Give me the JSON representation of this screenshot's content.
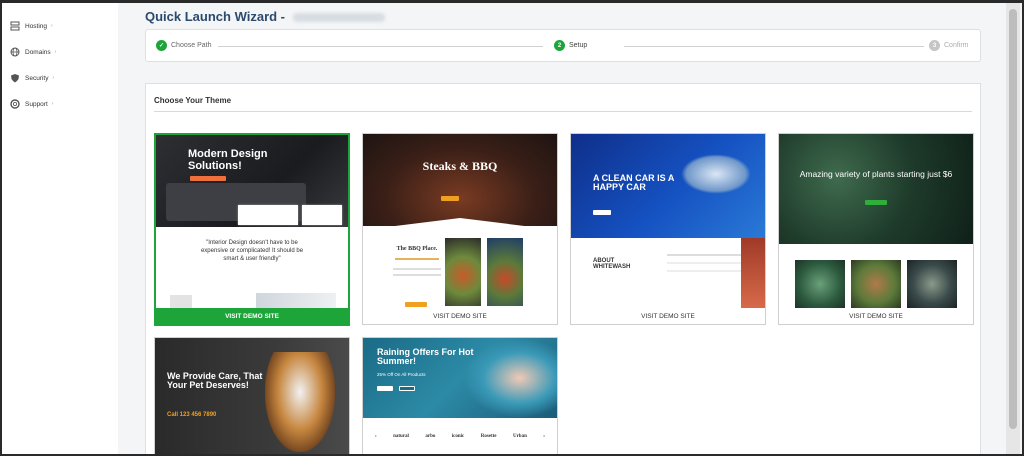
{
  "sidebar": {
    "items": [
      {
        "label": "Hosting",
        "icon": "server-icon"
      },
      {
        "label": "Domains",
        "icon": "globe-icon"
      },
      {
        "label": "Security",
        "icon": "shield-icon"
      },
      {
        "label": "Support",
        "icon": "lifebuoy-icon"
      }
    ]
  },
  "header": {
    "title": "Quick Launch Wizard -"
  },
  "wizard": {
    "steps": [
      {
        "label": "Choose Path",
        "number": "✓",
        "state": "done"
      },
      {
        "label": "Setup",
        "number": "2",
        "state": "current"
      },
      {
        "label": "Confirm",
        "number": "3",
        "state": "pending"
      }
    ]
  },
  "themes": {
    "heading": "Choose Your Theme",
    "visit_label": "VISIT DEMO SITE",
    "cards": [
      {
        "headline": "Modern Design Solutions!",
        "quote": "\"Interior Design doesn't have to be expensive or complicated! It should be smart & user friendly\"",
        "selected": true
      },
      {
        "headline": "Steaks & BBQ",
        "sub": "The BBQ Place.",
        "selected": false
      },
      {
        "headline": "A CLEAN CAR IS A HAPPY CAR",
        "sub": "ABOUT WHITEWASH",
        "selected": false
      },
      {
        "headline": "Amazing variety of plants starting just $6",
        "selected": false
      },
      {
        "headline": "We Provide Care, That Your Pet Deserves!",
        "phone": "Call 123 456 7890",
        "selected": false
      },
      {
        "headline": "Raining Offers For Hot Summer!",
        "sub": "25% Off On All Products",
        "brands": [
          "natural",
          "arbo",
          "iconic",
          "Rosette",
          "Urban"
        ],
        "selected": false
      }
    ]
  },
  "colors": {
    "accent": "#1ea53a",
    "title": "#2b4a6e"
  }
}
